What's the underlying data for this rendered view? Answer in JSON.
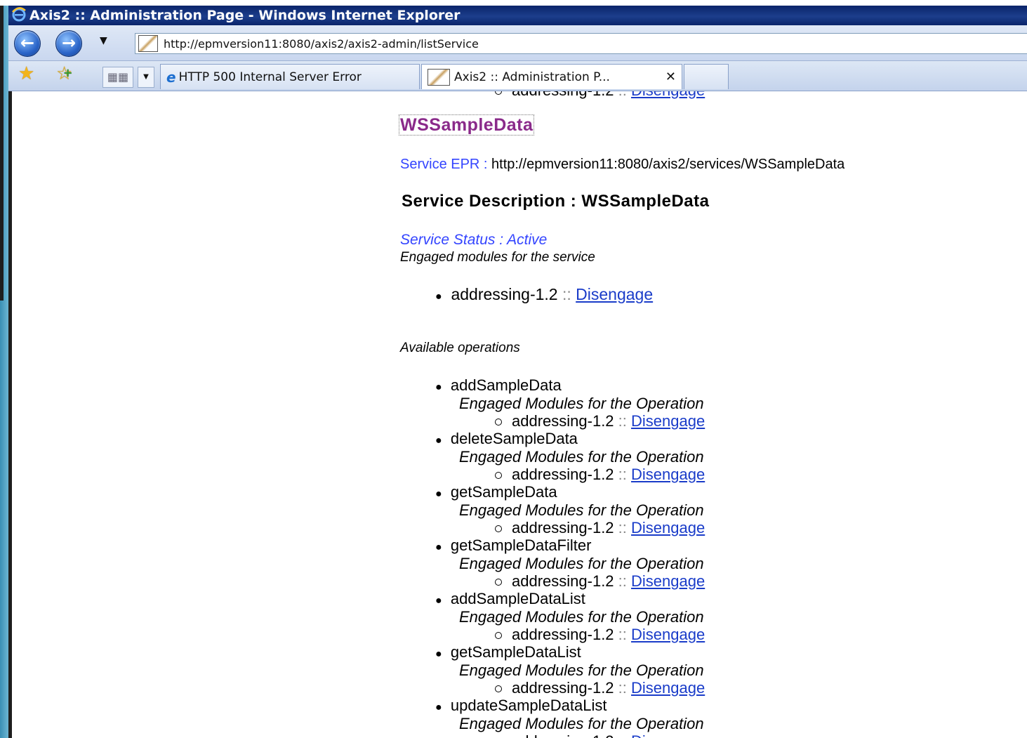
{
  "window": {
    "title": "Axis2 :: Administration Page - Windows Internet Explorer"
  },
  "navbar": {
    "url": "http://epmversion11:8080/axis2/axis2-admin/listService"
  },
  "tabs": [
    {
      "label": "HTTP 500 Internal Server Error"
    },
    {
      "label": "Axis2 :: Administration P...",
      "active": true
    }
  ],
  "page": {
    "cut_top_line": "addressing-1.2 :: Disengage",
    "service_name": "WSSampleData",
    "service_epr_label": "Service EPR :",
    "service_epr_value": "http://epmversion11:8080/axis2/services/WSSampleData",
    "service_description": "Service Description : WSSampleData",
    "service_status": "Service Status : Active",
    "engaged_modules_label": "Engaged modules for the service",
    "service_modules": [
      {
        "name": "addressing-1.2",
        "sep": "::",
        "action": "Disengage"
      }
    ],
    "available_operations_label": "Available operations",
    "operation_modules_label": "Engaged Modules for the Operation",
    "module_name": "addressing-1.2",
    "module_sep": "::",
    "module_action": "Disengage",
    "operations": [
      "addSampleData",
      "deleteSampleData",
      "getSampleData",
      "getSampleDataFilter",
      "addSampleDataList",
      "getSampleDataList",
      "updateSampleDataList"
    ]
  },
  "colors": {
    "service_name": "#8a2a8a",
    "label_blue": "#3344ff",
    "link": "#1a3cc9",
    "titlebar": "#0a246a"
  }
}
